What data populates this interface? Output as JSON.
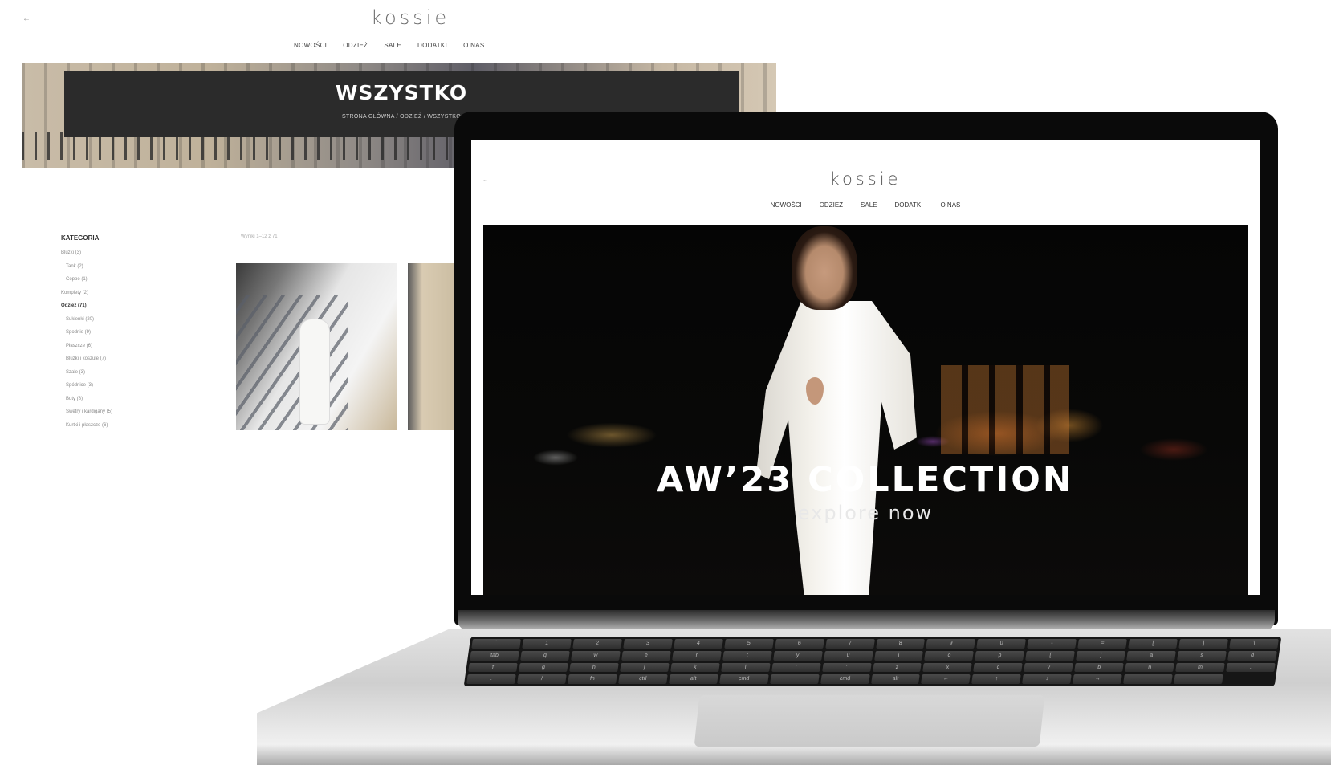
{
  "background_page": {
    "logo": "kossie",
    "back_arrow": "←",
    "nav": [
      "NOWOŚCI",
      "ODZIEŻ",
      "SALE",
      "DODATKI",
      "O NAS"
    ],
    "banner_title": "WSZYSTKO",
    "breadcrumb": "STRONA GŁÓWNA / ODZIEŻ / WSZYSTKO",
    "sidebar_title": "KATEGORIA",
    "categories": [
      {
        "label": "Bluzki (3)",
        "sub": false,
        "bold": false
      },
      {
        "label": "Tank (2)",
        "sub": true,
        "bold": false
      },
      {
        "label": "Coppe (1)",
        "sub": true,
        "bold": false
      },
      {
        "label": "Komplety (2)",
        "sub": false,
        "bold": false
      },
      {
        "label": "Odzież (71)",
        "sub": false,
        "bold": true
      },
      {
        "label": "Sukienki (20)",
        "sub": true,
        "bold": false
      },
      {
        "label": "Spodnie (9)",
        "sub": true,
        "bold": false
      },
      {
        "label": "Płaszcze (6)",
        "sub": true,
        "bold": false
      },
      {
        "label": "Bluzki i koszule (7)",
        "sub": true,
        "bold": false
      },
      {
        "label": "Szale (3)",
        "sub": true,
        "bold": false
      },
      {
        "label": "Spódnice (3)",
        "sub": true,
        "bold": false
      },
      {
        "label": "Buty (8)",
        "sub": true,
        "bold": false
      },
      {
        "label": "Swetry i kardigany (5)",
        "sub": true,
        "bold": false
      },
      {
        "label": "Kurtki i płaszcze (6)",
        "sub": true,
        "bold": false
      }
    ],
    "results_count": "Wyniki 1–12 z 71"
  },
  "laptop_screen": {
    "logo": "kossie",
    "back_arrow": "←",
    "nav": [
      "NOWOŚCI",
      "ODZIEŻ",
      "SALE",
      "DODATKI",
      "O NAS"
    ],
    "hero_title": "AW’23 COLLECTION",
    "hero_cta": "explore now"
  },
  "keyboard_keys": [
    "`",
    "1",
    "2",
    "3",
    "4",
    "5",
    "6",
    "7",
    "8",
    "9",
    "0",
    "-",
    "=",
    "[",
    "]",
    "\\",
    "tab",
    "q",
    "w",
    "e",
    "r",
    "t",
    "y",
    "u",
    "i",
    "o",
    "p",
    "[",
    "]",
    "a",
    "s",
    "d",
    "f",
    "g",
    "h",
    "j",
    "k",
    "l",
    ";",
    "'",
    "z",
    "x",
    "c",
    "v",
    "b",
    "n",
    "m",
    ",",
    ".",
    "/",
    "fn",
    "ctrl",
    "alt",
    "cmd",
    "",
    "cmd",
    "alt",
    "←",
    "↑",
    "↓",
    "→",
    "",
    ""
  ],
  "colors": {
    "banner": "#2b2b2b",
    "hero_bg": "#050505",
    "laptop_bezel": "#0a0a0a",
    "laptop_base": "#d6d6d6"
  }
}
